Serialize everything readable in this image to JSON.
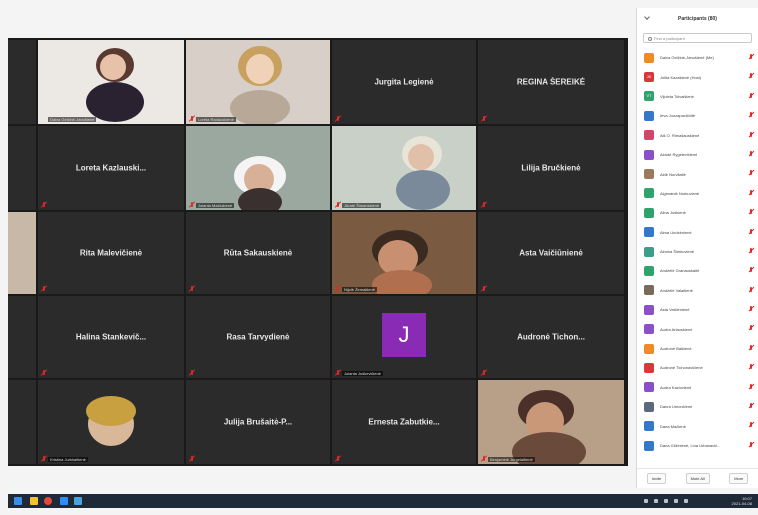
{
  "panel": {
    "title": "Participants (80)",
    "search_placeholder": "Find a participant",
    "buttons": {
      "invite": "Invite",
      "mute_all": "Mute All",
      "more": "More"
    },
    "participants": [
      {
        "initials": "",
        "name": "Daiva Gelžinė-Janušienė (Me)",
        "color": "#f08a24"
      },
      {
        "initials": "JK",
        "name": "Jolita Kazakienė (Host)",
        "color": "#d93838"
      },
      {
        "initials": "VT",
        "name": "Vijoleta Tolvaišienė",
        "color": "#2fa36b"
      },
      {
        "initials": "",
        "name": "Ieva Juozapavičiūtė",
        "color": "#3478c9"
      },
      {
        "initials": "",
        "name": "Aiš O. Rimašauskienė",
        "color": "#d4456a"
      },
      {
        "initials": "",
        "name": "Aldutė Rygelevičienė",
        "color": "#8a4fc9"
      },
      {
        "initials": "",
        "name": "Aldė Norvilaitė",
        "color": "#9a7a5a"
      },
      {
        "initials": "",
        "name": "Algimantė Norkuvienė",
        "color": "#2fa36b"
      },
      {
        "initials": "",
        "name": "Alina Juškienė",
        "color": "#2fa36b"
      },
      {
        "initials": "",
        "name": "Alma Undzėnienė",
        "color": "#3478c9"
      },
      {
        "initials": "",
        "name": "Almina Šimkuvienė",
        "color": "#3a9e8a"
      },
      {
        "initials": "",
        "name": "Andželė Granauskaitė",
        "color": "#2fa36b"
      },
      {
        "initials": "",
        "name": "Andželė Valaitienė",
        "color": "#7a6a5a"
      },
      {
        "initials": "",
        "name": "Asta Vaičienienė",
        "color": "#8a4fc9"
      },
      {
        "initials": "",
        "name": "Audra Arlauskienė",
        "color": "#8a4fc9"
      },
      {
        "initials": "",
        "name": "Audronė Balkienė",
        "color": "#f08a24"
      },
      {
        "initials": "",
        "name": "Audronė Tichonavičienė",
        "color": "#d93838"
      },
      {
        "initials": "",
        "name": "Audra Kazlovienė",
        "color": "#8a4fc9"
      },
      {
        "initials": "",
        "name": "Danra Umončienė",
        "color": "#5a6a7a"
      },
      {
        "initials": "",
        "name": "Dana Mačienė",
        "color": "#3478c9"
      },
      {
        "initials": "",
        "name": "Dana Gilžinienė, Lina Urbanavič...",
        "color": "#3478c9"
      }
    ]
  },
  "tiles": [
    {
      "type": "video",
      "caption": "Daiva Gelžinė-Janušienė",
      "muted": false,
      "active": true,
      "scene": "a"
    },
    {
      "type": "video",
      "caption": "Loreta Radauskienė",
      "muted": true,
      "scene": "b"
    },
    {
      "type": "name",
      "name": "Jurgita Legienė",
      "muted": true
    },
    {
      "type": "name",
      "name": "REGINA ŠEREIKĖ",
      "muted": true
    },
    {
      "type": "name",
      "name": "Loreta Kazlauski...",
      "muted": true
    },
    {
      "type": "video",
      "caption": "Jolanta Mačiukienė",
      "muted": true,
      "scene": "c"
    },
    {
      "type": "video",
      "caption": "Jūratė Šimanskienė",
      "muted": true,
      "scene": "d"
    },
    {
      "type": "name",
      "name": "Lilija Bručkienė",
      "muted": true
    },
    {
      "type": "name",
      "name": "Rita Malevičienė",
      "muted": true
    },
    {
      "type": "name",
      "name": "Rūta Sakauskienė",
      "muted": true
    },
    {
      "type": "video",
      "caption": "Nijolė Žemaitienė",
      "muted": true,
      "scene": "e"
    },
    {
      "type": "name",
      "name": "Asta Vaičiūnienė",
      "muted": true
    },
    {
      "type": "name",
      "name": "Halina Stankevič...",
      "muted": true
    },
    {
      "type": "name",
      "name": "Rasa Tarvydienė",
      "muted": true
    },
    {
      "type": "avatar",
      "initial": "J",
      "caption": "Jolanta Juškevičienė",
      "muted": true
    },
    {
      "type": "name",
      "name": "Audronė Tichon...",
      "muted": true
    },
    {
      "type": "video",
      "caption": "Kristina Jurkšaitienė",
      "muted": true,
      "scene": "f"
    },
    {
      "type": "name",
      "name": "Julija Brušaitė-P...",
      "muted": true
    },
    {
      "type": "name",
      "name": "Ernesta Zabutkie...",
      "muted": true
    },
    {
      "type": "video",
      "caption": "Benjaminė Jurgelaitienė",
      "muted": true,
      "scene": "g"
    }
  ],
  "taskbar": {
    "time": "10:07",
    "date": "2021-04-08"
  }
}
